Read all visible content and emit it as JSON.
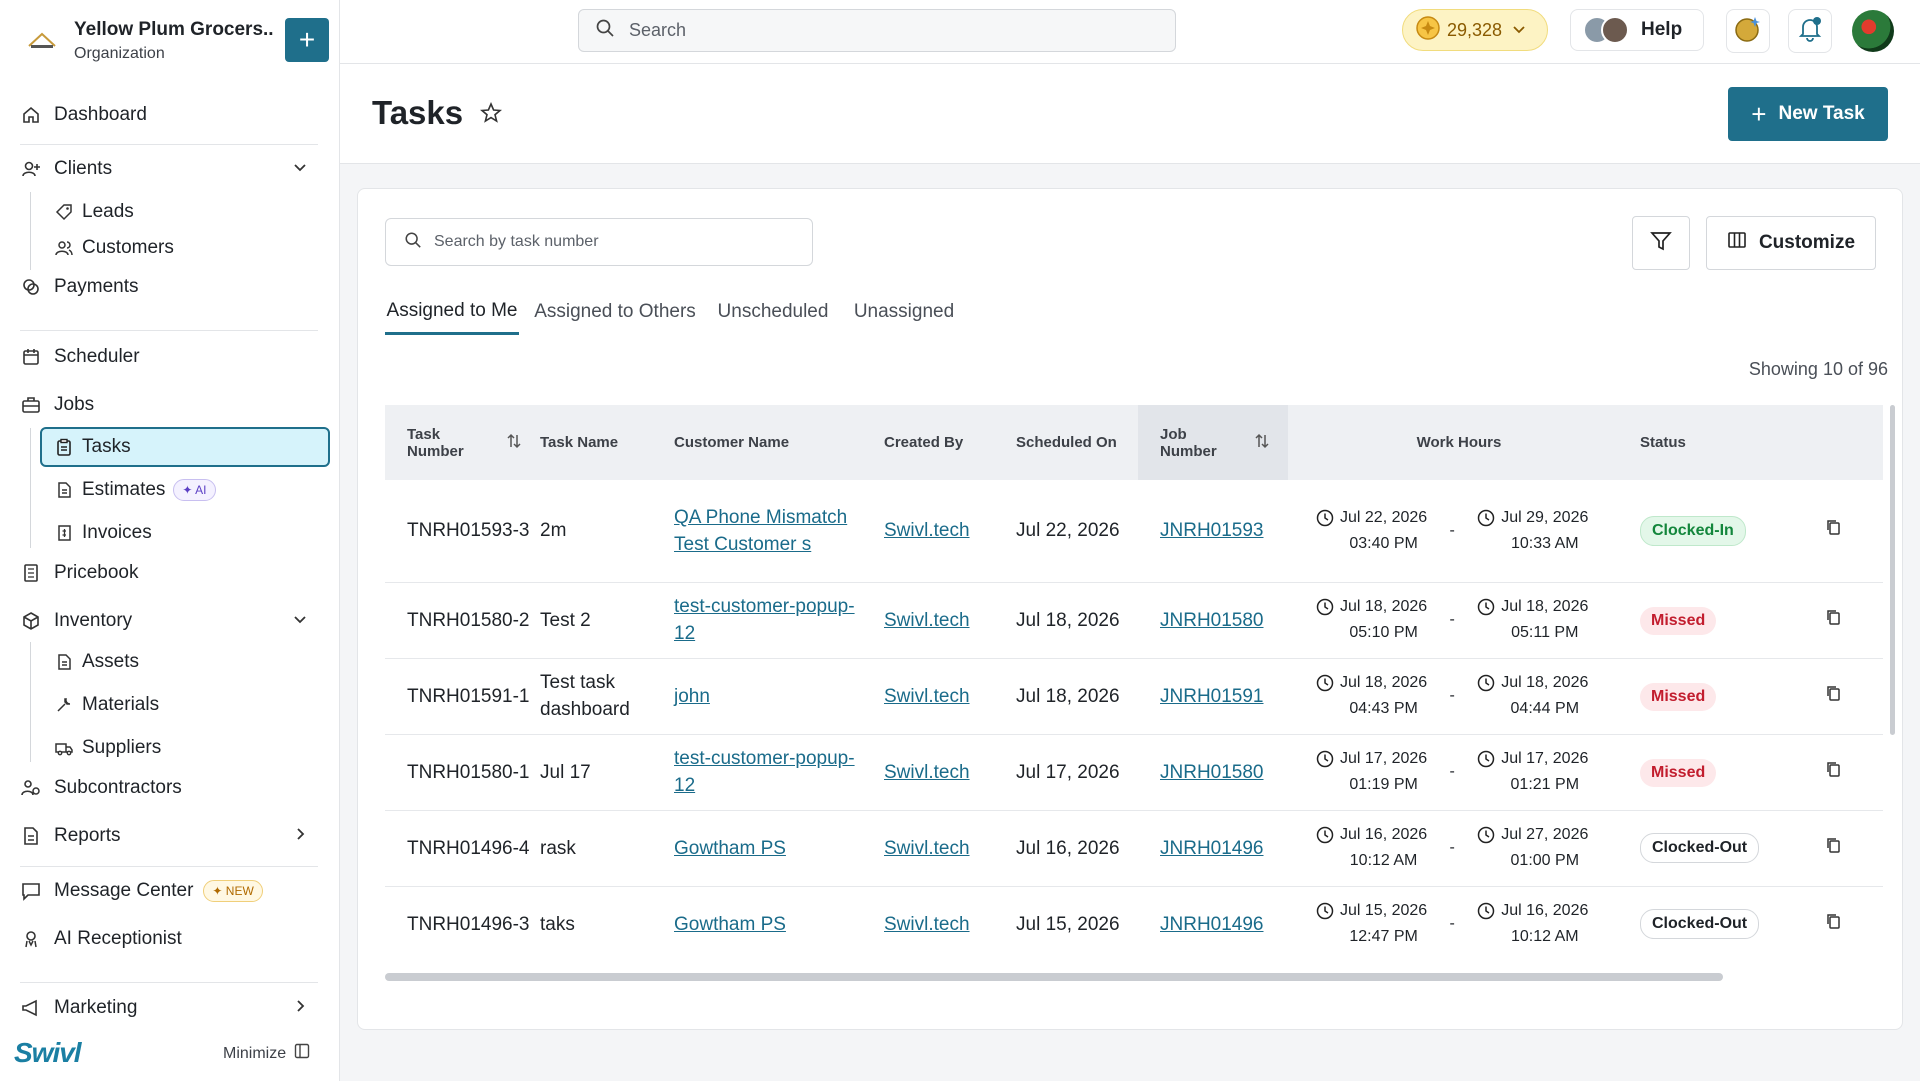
{
  "org": {
    "name": "Yellow Plum Grocers...",
    "subtitle": "Organization"
  },
  "sidebar": {
    "dashboard": "Dashboard",
    "clients": "Clients",
    "leads": "Leads",
    "customers": "Customers",
    "payments": "Payments",
    "scheduler": "Scheduler",
    "jobs": "Jobs",
    "tasks": "Tasks",
    "estimates": "Estimates",
    "estimates_badge": "AI",
    "invoices": "Invoices",
    "pricebook": "Pricebook",
    "inventory": "Inventory",
    "assets": "Assets",
    "materials": "Materials",
    "suppliers": "Suppliers",
    "subcontractors": "Subcontractors",
    "reports": "Reports",
    "message_center": "Message Center",
    "message_badge": "NEW",
    "ai_receptionist": "AI Receptionist",
    "marketing": "Marketing",
    "brand": "Swivl",
    "minimize": "Minimize"
  },
  "topbar": {
    "search_placeholder": "Search",
    "credits": "29,328",
    "help": "Help"
  },
  "page": {
    "title": "Tasks",
    "new_task": "New Task"
  },
  "toolbar": {
    "search_placeholder": "Search by task number",
    "customize": "Customize"
  },
  "tabs": [
    "Assigned to Me",
    "Assigned to Others",
    "Unscheduled",
    "Unassigned"
  ],
  "showing": "Showing 10 of 96",
  "table": {
    "headers": {
      "task_number": "Task Number",
      "task_name": "Task Name",
      "customer_name": "Customer Name",
      "created_by": "Created By",
      "scheduled_on": "Scheduled On",
      "job_number": "Job Number",
      "work_hours": "Work Hours",
      "status": "Status"
    },
    "rows": [
      {
        "task_number": "TNRH01593-3",
        "task_name": "2m",
        "customer": "QA Phone Mismatch Test Customer s",
        "created_by": "Swivl.tech",
        "scheduled": "Jul 22, 2026",
        "job": "JNRH01593",
        "start_date": "Jul 22, 2026",
        "start_time": "03:40 PM",
        "end_date": "Jul 29, 2026",
        "end_time": "10:33 AM",
        "status": "Clocked-In"
      },
      {
        "task_number": "TNRH01580-2",
        "task_name": "Test 2",
        "customer": "test-customer-popup-12",
        "created_by": "Swivl.tech",
        "scheduled": "Jul 18, 2026",
        "job": "JNRH01580",
        "start_date": "Jul 18, 2026",
        "start_time": "05:10 PM",
        "end_date": "Jul 18, 2026",
        "end_time": "05:11 PM",
        "status": "Missed"
      },
      {
        "task_number": "TNRH01591-1",
        "task_name": "Test task dashboard",
        "customer": "john",
        "created_by": "Swivl.tech",
        "scheduled": "Jul 18, 2026",
        "job": "JNRH01591",
        "start_date": "Jul 18, 2026",
        "start_time": "04:43 PM",
        "end_date": "Jul 18, 2026",
        "end_time": "04:44 PM",
        "status": "Missed"
      },
      {
        "task_number": "TNRH01580-1",
        "task_name": "Jul 17",
        "customer": "test-customer-popup-12",
        "created_by": "Swivl.tech",
        "scheduled": "Jul 17, 2026",
        "job": "JNRH01580",
        "start_date": "Jul 17, 2026",
        "start_time": "01:19 PM",
        "end_date": "Jul 17, 2026",
        "end_time": "01:21 PM",
        "status": "Missed"
      },
      {
        "task_number": "TNRH01496-4",
        "task_name": "rask",
        "customer": "Gowtham PS",
        "created_by": "Swivl.tech",
        "scheduled": "Jul 16, 2026",
        "job": "JNRH01496",
        "start_date": "Jul 16, 2026",
        "start_time": "10:12 AM",
        "end_date": "Jul 27, 2026",
        "end_time": "01:00 PM",
        "status": "Clocked-Out"
      },
      {
        "task_number": "TNRH01496-3",
        "task_name": "taks",
        "customer": "Gowtham PS",
        "created_by": "Swivl.tech",
        "scheduled": "Jul 15, 2026",
        "job": "JNRH01496",
        "start_date": "Jul 15, 2026",
        "start_time": "12:47 PM",
        "end_date": "Jul 16, 2026",
        "end_time": "10:12 AM",
        "status": "Clocked-Out"
      }
    ]
  },
  "colors": {
    "primary": "#1f6f8b",
    "active_bg": "#d6f3fb",
    "missed": "#c21d2e",
    "clocked_in": "#13863c"
  }
}
